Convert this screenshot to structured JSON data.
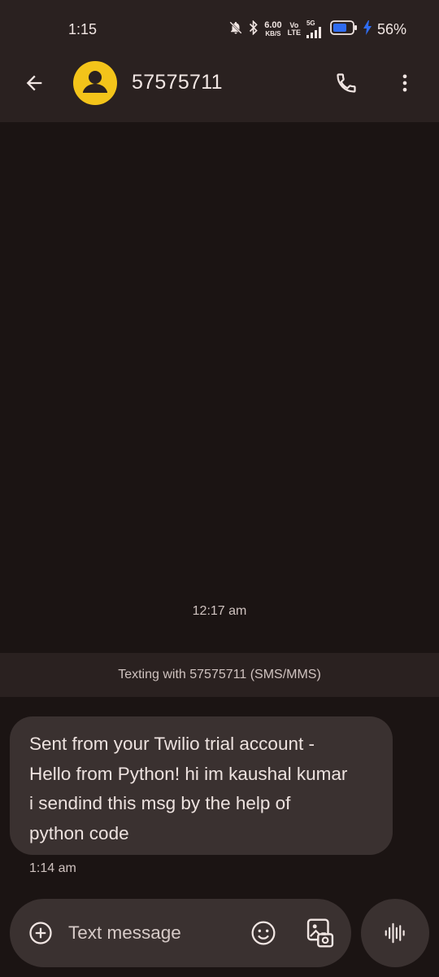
{
  "status_bar": {
    "time": "1:15",
    "speed_value": "6.00",
    "speed_unit": "KB/S",
    "volte_top": "Vo",
    "volte_bottom": "LTE",
    "network": "5G",
    "battery_percent": "56%",
    "icons": [
      "silent-bell-icon",
      "bluetooth-icon",
      "signal-icon",
      "battery-icon",
      "charging-bolt-icon"
    ]
  },
  "app_bar": {
    "contact_name": "57575711",
    "icons": [
      "back-arrow-icon",
      "person-avatar-icon",
      "phone-icon",
      "more-vert-icon"
    ]
  },
  "conversation": {
    "divider_time": "12:17 am",
    "info_text": "Texting with 57575711 (SMS/MMS)",
    "messages": [
      {
        "lines": [
          "Sent from your Twilio trial account -",
          "Hello from Python! hi im kaushal kumar",
          "i sendind this msg by the help of",
          "python code"
        ],
        "time": "1:14 am"
      }
    ]
  },
  "composer": {
    "placeholder": "Text message",
    "icons": [
      "add-circle-icon",
      "emoji-icon",
      "gallery-icon",
      "voice-waveform-icon"
    ]
  },
  "colors": {
    "background": "#1b1413",
    "bar": "#2a2120",
    "bubble": "#3a3130",
    "avatar": "#f3c41a",
    "battery_fill": "#2f6cf1"
  }
}
